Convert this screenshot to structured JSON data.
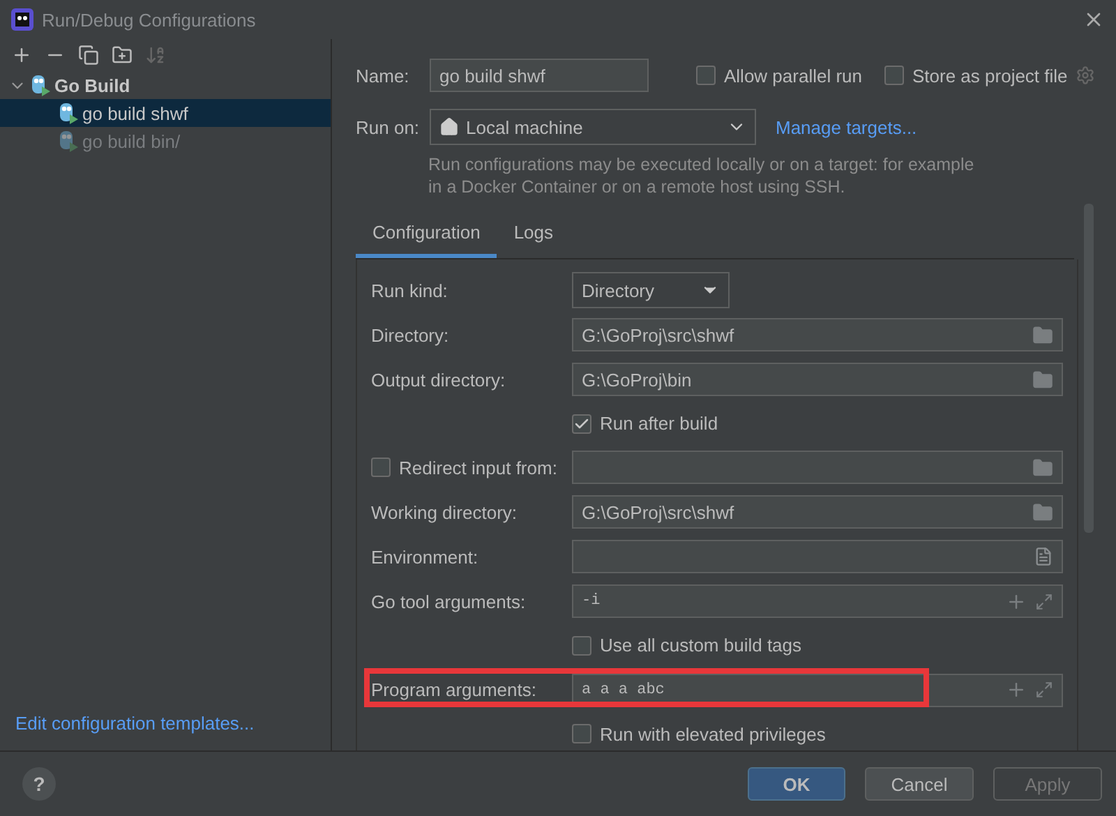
{
  "window": {
    "title": "Run/Debug Configurations"
  },
  "sidebar": {
    "tree": [
      {
        "label": "Go Build",
        "expanded": true,
        "selected": false,
        "dimmed": false,
        "children": [
          {
            "label": "go build shwf",
            "selected": true,
            "dimmed": false
          },
          {
            "label": "go build bin/",
            "selected": false,
            "dimmed": true
          }
        ]
      }
    ],
    "footer_link": "Edit configuration templates..."
  },
  "name": {
    "label": "Name:",
    "value": "go build shwf"
  },
  "options": [
    {
      "label": "Allow parallel run",
      "checked": false
    },
    {
      "label": "Store as project file",
      "checked": false
    }
  ],
  "run_on": {
    "label": "Run on:",
    "value": "Local machine",
    "link": "Manage targets...",
    "hint": "Run configurations may be executed locally or on a target: for example in a Docker Container or on a remote host using SSH."
  },
  "tabs": [
    {
      "label": "Configuration",
      "selected": true
    },
    {
      "label": "Logs",
      "selected": false
    }
  ],
  "rows": [
    {
      "kind": "dropdown",
      "label": "Run kind:",
      "value": "Directory"
    },
    {
      "kind": "path",
      "label": "Directory:",
      "value": "G:\\GoProj\\src\\shwf"
    },
    {
      "kind": "path",
      "label": "Output directory:",
      "value": "G:\\GoProj\\bin"
    },
    {
      "kind": "checkbox",
      "label": "Run after build",
      "checked": true
    },
    {
      "kind": "checkpath",
      "label": "Redirect input from:",
      "checked": false,
      "value": ""
    },
    {
      "kind": "path",
      "label": "Working directory:",
      "value": "G:\\GoProj\\src\\shwf"
    },
    {
      "kind": "env",
      "label": "Environment:",
      "value": ""
    },
    {
      "kind": "args",
      "label": "Go tool arguments:",
      "value": "-i",
      "highlighted": false
    },
    {
      "kind": "checkbox",
      "label": "Use all custom build tags",
      "checked": false
    },
    {
      "kind": "args",
      "label": "Program arguments:",
      "value": "a a a abc",
      "highlighted": true
    },
    {
      "kind": "checkbox",
      "label": "Run with elevated privileges",
      "checked": false
    }
  ],
  "buttons": [
    {
      "label": "OK",
      "kind": "primary",
      "disabled": false
    },
    {
      "label": "Cancel",
      "kind": "normal",
      "disabled": false
    },
    {
      "label": "Apply",
      "kind": "normal",
      "disabled": true
    }
  ],
  "help": "?"
}
